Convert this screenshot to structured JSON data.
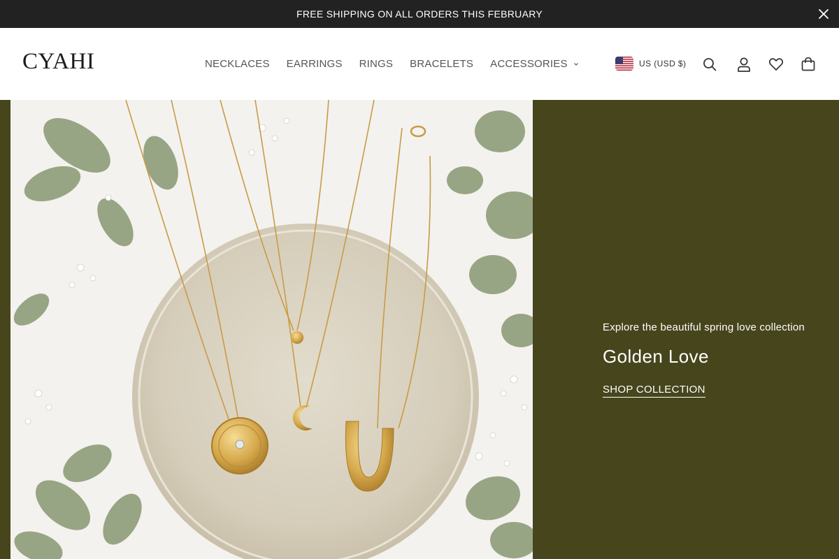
{
  "announcement": {
    "text": "FREE SHIPPING ON ALL ORDERS THIS FEBRUARY",
    "close_icon": "close-icon"
  },
  "header": {
    "logo": "CYAHI",
    "nav": [
      {
        "label": "NECKLACES"
      },
      {
        "label": "EARRINGS"
      },
      {
        "label": "RINGS"
      },
      {
        "label": "BRACELETS"
      },
      {
        "label": "ACCESSORIES",
        "has_dropdown": true
      }
    ],
    "currency": {
      "label": "US (USD $)",
      "flag_icon": "us-flag-icon"
    },
    "icons": [
      "search-icon",
      "account-icon",
      "wishlist-heart-icon",
      "cart-bag-icon"
    ]
  },
  "hero": {
    "image": "gold-necklaces-on-ceramic-plate-with-eucalyptus",
    "eyebrow": "Explore the beautiful spring love collection",
    "title": "Golden Love",
    "cta": "SHOP COLLECTION"
  },
  "colors": {
    "announcement_bg": "#222222",
    "hero_bg": "#47451c",
    "text_white": "#ffffff",
    "nav_text": "#555555"
  }
}
